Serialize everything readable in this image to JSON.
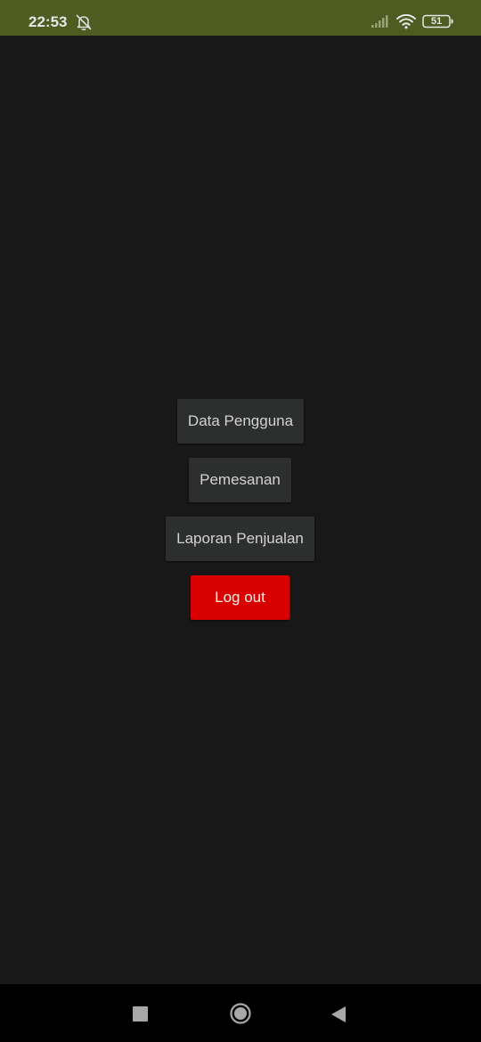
{
  "status_bar": {
    "time": "22:53",
    "battery": "51",
    "icons": [
      "alarm-off-icon",
      "signal-icon",
      "wifi-icon",
      "battery-icon"
    ]
  },
  "menu": {
    "data_pengguna": "Data Pengguna",
    "pemesanan": "Pemesanan",
    "laporan_penjualan": "Laporan Penjualan",
    "logout": "Log out"
  },
  "colors": {
    "status_bar": "#4e5c22",
    "background": "#181818",
    "button": "#2d2e2e",
    "logout_button": "#d80000"
  },
  "nav_bar": {
    "icons": [
      "recent-apps-icon",
      "home-icon",
      "back-icon"
    ]
  }
}
